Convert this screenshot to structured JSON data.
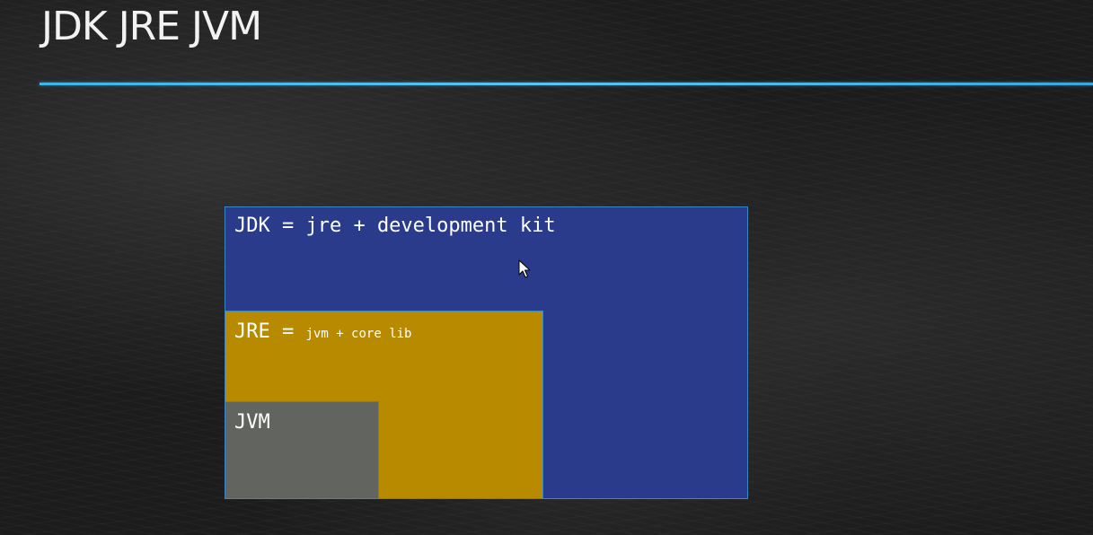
{
  "slide": {
    "title": "JDK JRE JVM"
  },
  "diagram": {
    "jdk": {
      "label": "JDK = jre + development kit",
      "color": "#2a3b8c"
    },
    "jre": {
      "label_main": "JRE = ",
      "label_small": "jvm + core lib",
      "color": "#b88a00"
    },
    "jvm": {
      "label": "JVM",
      "color": "#626460"
    },
    "border_color": "#3b86c6"
  },
  "accent": {
    "underline_color": "#4dbcf0",
    "background_color": "#1c1c1c"
  },
  "icons": {
    "cursor": "mouse-pointer-icon"
  }
}
